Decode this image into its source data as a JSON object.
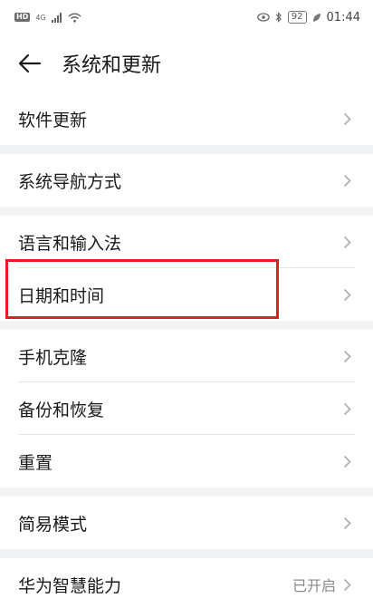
{
  "status_bar": {
    "hd": "HD",
    "signal_text": "4G",
    "battery": "92",
    "time": "01:44"
  },
  "header": {
    "title": "系统和更新"
  },
  "sections": [
    {
      "items": [
        {
          "label": "软件更新"
        }
      ]
    },
    {
      "items": [
        {
          "label": "系统导航方式"
        }
      ]
    },
    {
      "items": [
        {
          "label": "语言和输入法"
        },
        {
          "label": "日期和时间"
        }
      ]
    },
    {
      "items": [
        {
          "label": "手机克隆"
        },
        {
          "label": "备份和恢复"
        },
        {
          "label": "重置"
        }
      ]
    },
    {
      "items": [
        {
          "label": "简易模式"
        }
      ]
    },
    {
      "items": [
        {
          "label": "华为智慧能力",
          "value": "已开启"
        }
      ]
    }
  ],
  "colors": {
    "highlight": "#e02020",
    "section_gap": "#f1f3f5"
  },
  "icons": {
    "back": "arrow-left-icon",
    "chevron": "chevron-right-icon"
  }
}
